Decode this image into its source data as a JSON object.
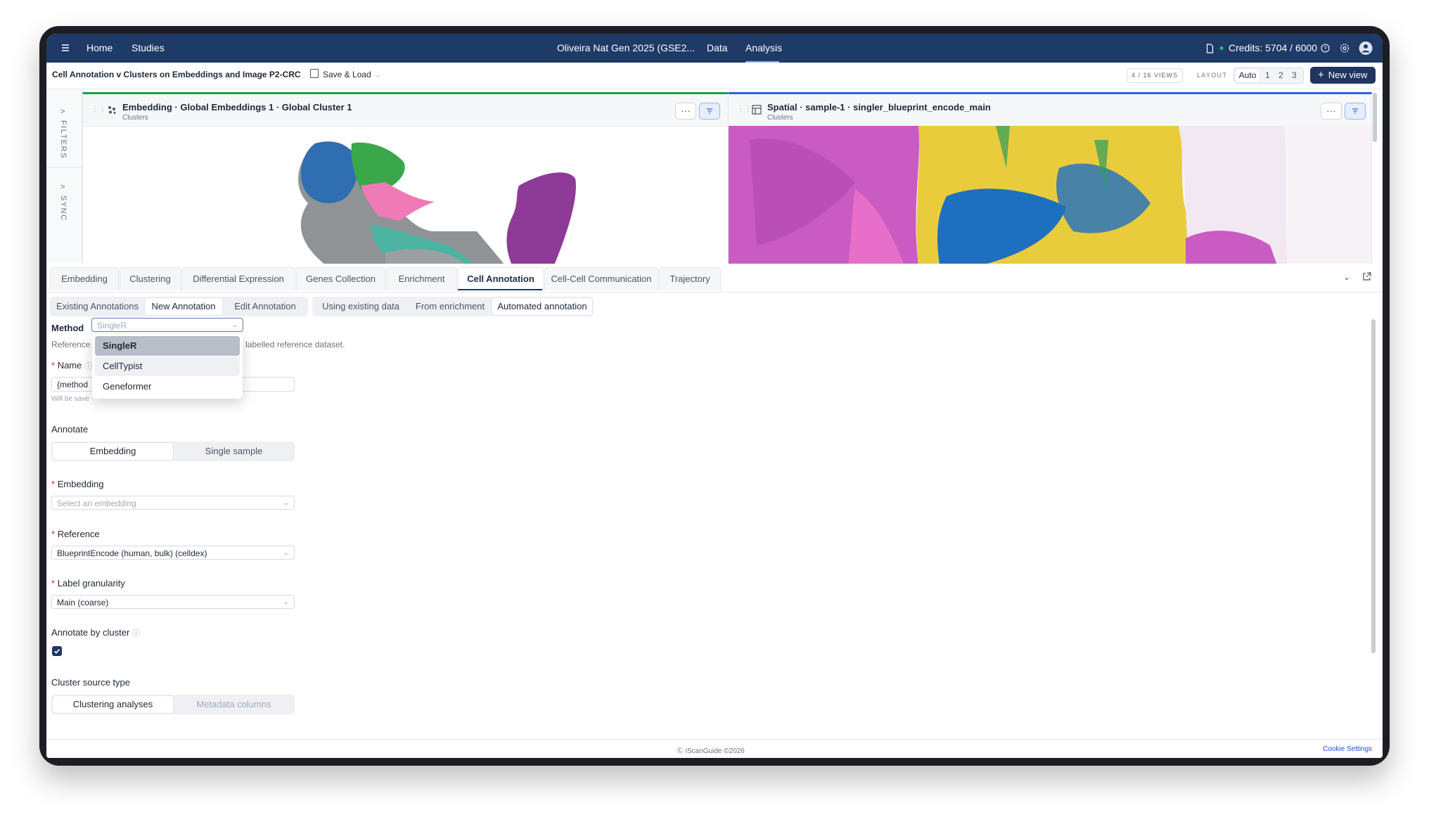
{
  "nav": {
    "menu_icon": "menu-icon",
    "home": "Home",
    "studies": "Studies",
    "project": "Oliveira Nat Gen 2025 (GSE2...",
    "data": "Data",
    "analysis": "Analysis",
    "credits": "Credits: 5704 / 6000",
    "status_color": "#22c55e"
  },
  "toolbar": {
    "title": "Cell Annotation v Clusters on Embeddings and Image P2-CRC",
    "save_load": "Save & Load",
    "views": "4 / 16 VIEWS",
    "layout_label": "LAYOUT",
    "layout_options": [
      "Auto",
      "1",
      "2",
      "3"
    ],
    "new_view": "New view"
  },
  "rail": {
    "filters": "FILTERS",
    "sync": "SYNC"
  },
  "panels": {
    "left": {
      "title": "Embedding · Global Embeddings 1 · Global Cluster 1",
      "subtitle": "Clusters",
      "accent": "#16a34a"
    },
    "right": {
      "title": "Spatial · sample-1 · singler_blueprint_encode_main",
      "subtitle": "Clusters",
      "accent": "#2563eb"
    }
  },
  "tabs": [
    "Embedding",
    "Clustering",
    "Differential Expression",
    "Genes Collection",
    "Enrichment",
    "Cell Annotation",
    "Cell-Cell Communication",
    "Trajectory"
  ],
  "active_tab": "Cell Annotation",
  "annotation_modes": [
    "Existing Annotations",
    "New Annotation",
    "Edit Annotation"
  ],
  "source_modes": [
    "Using existing data",
    "From enrichment",
    "Automated annotation"
  ],
  "form": {
    "method_label": "Method",
    "method_placeholder": "SingleR",
    "method_options": [
      "SingleR",
      "CellTypist",
      "Geneformer"
    ],
    "reference_desc_start": "Reference",
    "reference_desc_end": "labelled reference dataset.",
    "name_label": "Name",
    "name_value": "{method",
    "saved_hint": "Will be save",
    "annotate_label": "Annotate",
    "annotate_options": [
      "Embedding",
      "Single sample"
    ],
    "embedding_label": "Embedding",
    "embedding_placeholder": "Select an embedding",
    "reference_label": "Reference",
    "reference_value": "BlueprintEncode (human, bulk) (celldex)",
    "granularity_label": "Label granularity",
    "granularity_value": "Main (coarse)",
    "by_cluster_label": "Annotate by cluster",
    "by_cluster_checked": true,
    "cluster_source_label": "Cluster source type",
    "cluster_source_options": [
      "Clustering analyses",
      "Metadata columns"
    ]
  },
  "footer": {
    "copyright": "iScanGuide ©2026",
    "cookie": "Cookie Settings"
  },
  "colors": {
    "nav_bg": "#1e3a66",
    "primary_button": "#1f3560",
    "link": "#1d4ed8"
  }
}
